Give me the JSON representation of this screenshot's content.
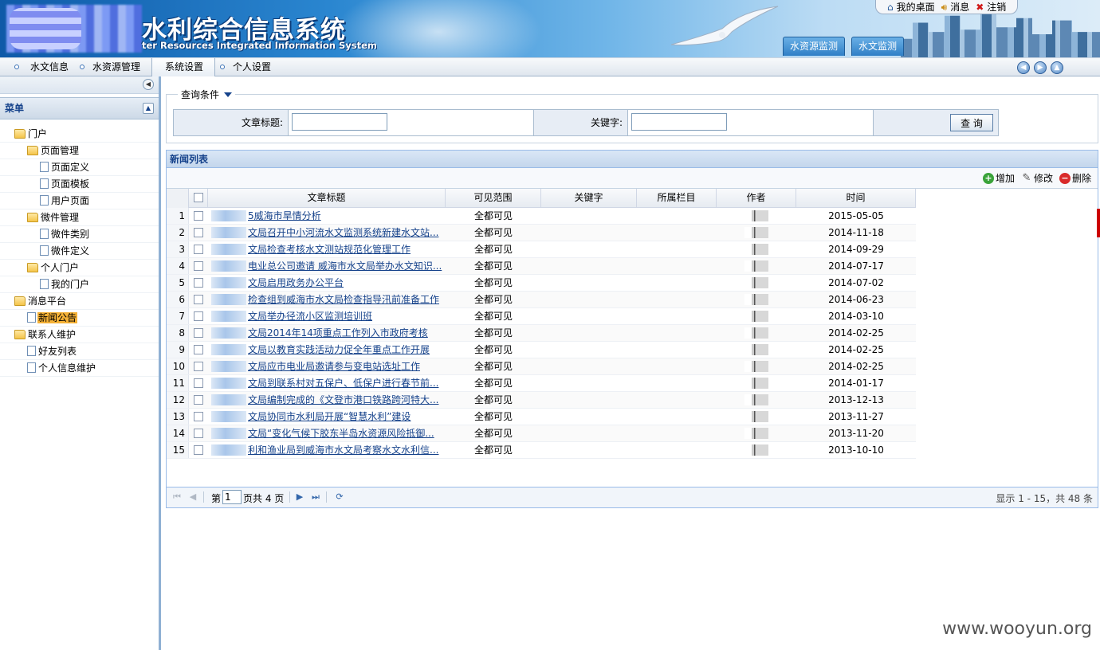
{
  "header": {
    "title": "水利综合信息系统",
    "subtitle": "ter Resources Integrated Information System",
    "top_links": [
      {
        "label": "我的桌面",
        "icon": "home-icon"
      },
      {
        "label": "消息",
        "icon": "speaker-icon"
      },
      {
        "label": "注销",
        "icon": "logout-x-icon"
      }
    ],
    "module_tabs": [
      "水资源监测",
      "水文监测"
    ]
  },
  "menubar": {
    "items": [
      "水文信息",
      "水资源管理",
      "系统设置",
      "个人设置"
    ],
    "active": "系统设置"
  },
  "sidebar": {
    "panel_title": "菜单",
    "tree": [
      {
        "label": "门户",
        "type": "folder",
        "level": 0
      },
      {
        "label": "页面管理",
        "type": "folder",
        "level": 1
      },
      {
        "label": "页面定义",
        "type": "file",
        "level": 2
      },
      {
        "label": "页面模板",
        "type": "file",
        "level": 2
      },
      {
        "label": "用户页面",
        "type": "file",
        "level": 2
      },
      {
        "label": "微件管理",
        "type": "folder",
        "level": 1
      },
      {
        "label": "微件类别",
        "type": "file",
        "level": 2
      },
      {
        "label": "微件定义",
        "type": "file",
        "level": 2
      },
      {
        "label": "个人门户",
        "type": "folder",
        "level": 1
      },
      {
        "label": "我的门户",
        "type": "file",
        "level": 2
      },
      {
        "label": "消息平台",
        "type": "folder",
        "level": 0
      },
      {
        "label": "新闻公告",
        "type": "file",
        "level": 1,
        "selected": true
      },
      {
        "label": "联系人维护",
        "type": "folder",
        "level": 0
      },
      {
        "label": "好友列表",
        "type": "file",
        "level": 1
      },
      {
        "label": "个人信息维护",
        "type": "file",
        "level": 1
      }
    ]
  },
  "query": {
    "legend": "查询条件",
    "title_label": "文章标题:",
    "title_value": "",
    "keyword_label": "关键字:",
    "keyword_value": "",
    "search_button": "查 询"
  },
  "grid": {
    "title": "新闻列表",
    "toolbar": {
      "add": "增加",
      "edit": "修改",
      "delete": "删除"
    },
    "columns": [
      "文章标题",
      "可见范围",
      "关键字",
      "所属栏目",
      "作者",
      "时间"
    ],
    "rows": [
      {
        "num": "1",
        "title": "5威海市旱情分析",
        "range": "全都可见",
        "keyword": "",
        "column": "",
        "time": "2015-05-05"
      },
      {
        "num": "2",
        "title": "文局召开中小河流水文监测系统新建水文站...",
        "range": "全都可见",
        "keyword": "",
        "column": "",
        "time": "2014-11-18"
      },
      {
        "num": "3",
        "title": "文局检查考核水文测站规范化管理工作",
        "range": "全都可见",
        "keyword": "",
        "column": "",
        "time": "2014-09-29"
      },
      {
        "num": "4",
        "title": "电业总公司邀请 威海市水文局举办水文知识...",
        "range": "全都可见",
        "keyword": "",
        "column": "",
        "time": "2014-07-17"
      },
      {
        "num": "5",
        "title": "文局启用政务办公平台",
        "range": "全都可见",
        "keyword": "",
        "column": "",
        "time": "2014-07-02"
      },
      {
        "num": "6",
        "title": "检查组到威海市水文局检查指导汛前准备工作",
        "range": "全都可见",
        "keyword": "",
        "column": "",
        "time": "2014-06-23"
      },
      {
        "num": "7",
        "title": "文局举办径流小区监测培训班",
        "range": "全都可见",
        "keyword": "",
        "column": "",
        "time": "2014-03-10"
      },
      {
        "num": "8",
        "title": "文局2014年14项重点工作列入市政府考核",
        "range": "全都可见",
        "keyword": "",
        "column": "",
        "time": "2014-02-25"
      },
      {
        "num": "9",
        "title": "文局以教育实践活动力促全年重点工作开展",
        "range": "全都可见",
        "keyword": "",
        "column": "",
        "time": "2014-02-25"
      },
      {
        "num": "10",
        "title": "文局应市电业局邀请参与变电站选址工作",
        "range": "全都可见",
        "keyword": "",
        "column": "",
        "time": "2014-02-25"
      },
      {
        "num": "11",
        "title": "文局到联系村对五保户、低保户进行春节前...",
        "range": "全都可见",
        "keyword": "",
        "column": "",
        "time": "2014-01-17"
      },
      {
        "num": "12",
        "title": "文局编制完成的《文登市港口铁路跨河特大...",
        "range": "全都可见",
        "keyword": "",
        "column": "",
        "time": "2013-12-13"
      },
      {
        "num": "13",
        "title": "文局协同市水利局开展“智慧水利”建设",
        "range": "全都可见",
        "keyword": "",
        "column": "",
        "time": "2013-11-27"
      },
      {
        "num": "14",
        "title": "文局“变化气候下胶东半岛水资源风险抵御...",
        "range": "全都可见",
        "keyword": "",
        "column": "",
        "time": "2013-11-20"
      },
      {
        "num": "15",
        "title": "利和渔业局到威海市水文局考察水文水利信...",
        "range": "全都可见",
        "keyword": "",
        "column": "",
        "time": "2013-10-10"
      }
    ]
  },
  "pager": {
    "page_prefix": "第",
    "page_value": "1",
    "page_suffix": "页共 4 页",
    "summary": "显示 1 - 15，共 48 条"
  },
  "watermark": "www.wooyun.org"
}
